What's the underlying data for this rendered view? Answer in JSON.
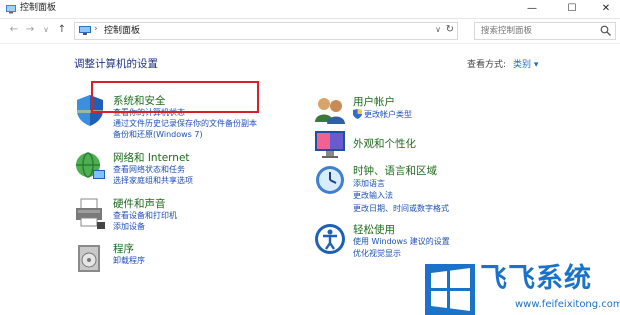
{
  "window": {
    "title": "控制面板",
    "minimize_icon": "—",
    "maximize_icon": "☐",
    "close_icon": "✕"
  },
  "nav": {
    "back_icon": "←",
    "forward_icon": "→",
    "recent_icon": "∨",
    "up_icon": "↑",
    "address_separator": "›",
    "breadcrumb": "控制面板",
    "address_dropdown_icon": "∨",
    "refresh_icon": "↻",
    "search_placeholder": "搜索控制面板"
  },
  "page": {
    "heading": "调整计算机的设置",
    "view_by_label": "查看方式:",
    "view_by_value": "类别 ▾"
  },
  "categories": [
    {
      "title": "系统和安全",
      "links": [
        "查看你的计算机状态",
        "通过文件历史记录保存你的文件备份副本",
        "备份和还原(Windows 7)"
      ]
    },
    {
      "title": "网络和 Internet",
      "links": [
        "查看网络状态和任务",
        "选择家庭组和共享选项"
      ]
    },
    {
      "title": "硬件和声音",
      "links": [
        "查看设备和打印机",
        "添加设备"
      ]
    },
    {
      "title": "程序",
      "links": [
        "卸载程序"
      ]
    },
    {
      "title": "用户帐户",
      "links": [
        "更改帐户类型"
      ]
    },
    {
      "title": "外观和个性化",
      "links": []
    },
    {
      "title": "时钟、语言和区域",
      "links": [
        "添加语言",
        "更改输入法",
        "更改日期、时间或数字格式"
      ]
    },
    {
      "title": "轻松使用",
      "links": [
        "使用 Windows 建议的设置",
        "优化视觉显示"
      ]
    }
  ],
  "watermark": {
    "brand": "飞飞系统",
    "url": "www.feifeixitong.com"
  },
  "colors": {
    "highlight": "#d7202a",
    "category_title": "#1e6b1e",
    "link": "#1e50b4",
    "heading": "#1e3287",
    "watermark": "#1a73c8"
  }
}
